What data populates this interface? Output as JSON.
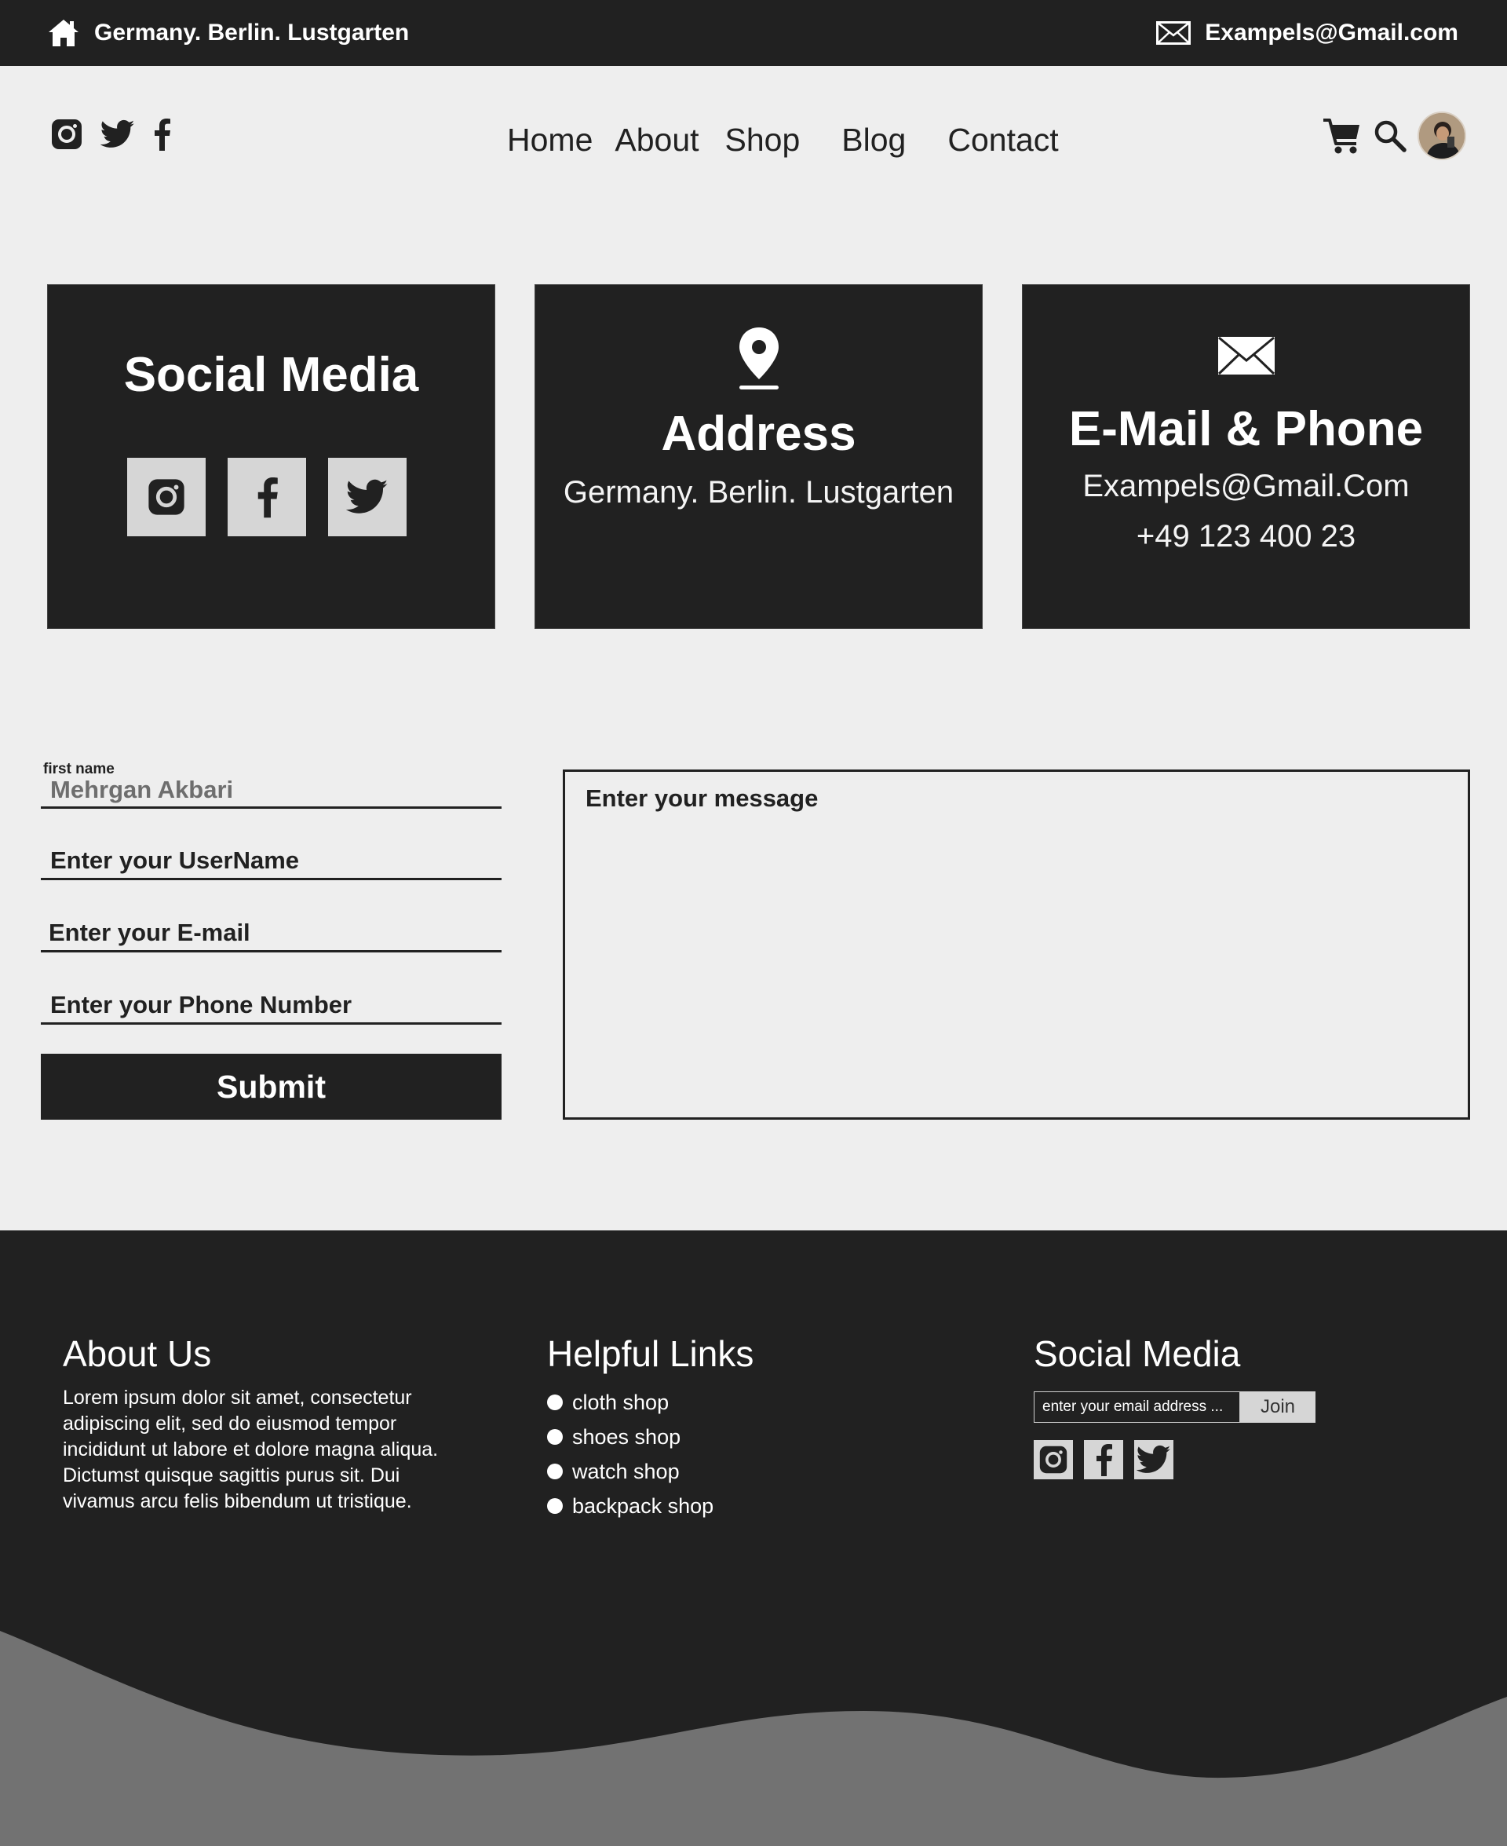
{
  "colors": {
    "dark": "#212121",
    "background": "#eeeeee",
    "light_gray": "#d6d6d6",
    "wave_gray": "#727272"
  },
  "topbar": {
    "address": "Germany. Berlin. Lustgarten",
    "email": "Exampels@Gmail.com"
  },
  "nav": {
    "items": [
      "Home",
      "About",
      "Shop",
      "Blog",
      "Contact"
    ]
  },
  "header_icons": {
    "social": [
      "instagram-icon",
      "twitter-icon",
      "facebook-icon"
    ],
    "tools": [
      "cart-icon",
      "search-icon"
    ]
  },
  "cards": {
    "social": {
      "title": "Social Media"
    },
    "address": {
      "title": "Address",
      "text": "Germany. Berlin. Lustgarten"
    },
    "contact": {
      "title": "E-Mail & Phone",
      "email": "Exampels@Gmail.Com",
      "phone": "+49 123 400 23"
    }
  },
  "form": {
    "first_name_label": "first name",
    "first_name_value": "Mehrgan Akbari",
    "username_placeholder": "Enter your UserName",
    "email_placeholder": "Enter your E-mail",
    "phone_placeholder": "Enter your Phone Number",
    "submit_label": "Submit",
    "message_placeholder": "Enter your message"
  },
  "footer": {
    "about_title": "About Us",
    "about_text": "Lorem ipsum dolor sit amet, consectetur adipiscing elit, sed do eiusmod tempor incididunt ut labore et dolore magna aliqua. Dictumst quisque sagittis purus sit. Dui vivamus arcu felis bibendum ut tristique.",
    "links_title": "Helpful Links",
    "links": [
      "cloth shop",
      "shoes shop",
      "watch shop",
      "backpack shop"
    ],
    "social_title": "Social Media",
    "subscribe_placeholder": "enter your email address ...",
    "join_label": "Join"
  }
}
